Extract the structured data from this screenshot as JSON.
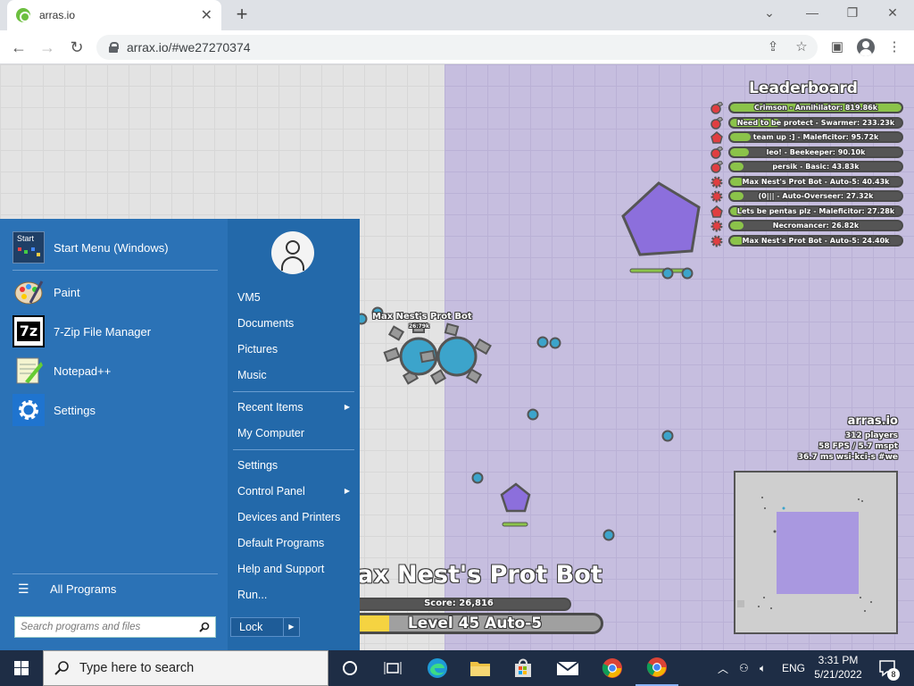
{
  "browser": {
    "tab_title": "arras.io",
    "url": "arrax.io/#we27270374"
  },
  "game": {
    "leaderboard_title": "Leaderboard",
    "leaderboard": [
      {
        "label": "Crimson - Annihilator: 819.86k",
        "fill": 1.0
      },
      {
        "label": "Need to be protect - Swarmer: 233.23k",
        "fill": 0.29
      },
      {
        "label": "team up :] - Maleficitor: 95.72k",
        "fill": 0.12
      },
      {
        "label": "leo! - Beekeeper: 90.10k",
        "fill": 0.11
      },
      {
        "label": "persik - Basic: 43.83k",
        "fill": 0.06
      },
      {
        "label": "Max Nest's Prot Bot - Auto-5: 40.43k",
        "fill": 0.05
      },
      {
        "label": "(0||| - Auto-Overseer: 27.32k",
        "fill": 0.04
      },
      {
        "label": "Lets be pentas plz - Maleficitor: 27.28k",
        "fill": 0.04
      },
      {
        "label": "Necromancer: 26.82k",
        "fill": 0.035
      },
      {
        "label": "Max Nest's Prot Bot - Auto-5: 24.40k",
        "fill": 0.03
      }
    ],
    "stats": {
      "site": "arras.io",
      "players": "312 players",
      "fps": "58 FPS / 5.7 mspt",
      "latency": "36.7 ms  wsi-kci-s #we"
    },
    "bot_label": "Max Nest's Prot Bot",
    "bot_score": "26.79k",
    "player_name": "ax Nest's Prot Bot",
    "score": "Score: 26,816",
    "level": "Level 45 Auto-5",
    "level_progress": 0.16,
    "colors": {
      "team_blue": "#3ca4cb",
      "pentagon": "#8c6fdc",
      "leader_green": "#8bc34a",
      "enemy_red": "#e03e41"
    }
  },
  "start_menu": {
    "pinned": [
      {
        "label": "Start Menu (Windows)",
        "icon": "start-menu-icon"
      },
      {
        "label": "Paint",
        "icon": "paint-palette-icon"
      },
      {
        "label": "7-Zip File Manager",
        "icon": "seven-zip-icon"
      },
      {
        "label": "Notepad++",
        "icon": "notepad-plus-plus-icon"
      },
      {
        "label": "Settings",
        "icon": "gear-icon"
      }
    ],
    "start_icon_text": "Start",
    "all_programs": "All Programs",
    "search_placeholder": "Search programs and files",
    "user": "VM5",
    "right_items": [
      {
        "label": "Documents"
      },
      {
        "label": "Pictures"
      },
      {
        "label": "Music"
      },
      {
        "label": "Recent Items"
      },
      {
        "label": "My Computer"
      },
      {
        "label": "Settings"
      },
      {
        "label": "Control Panel"
      },
      {
        "label": "Devices and Printers"
      },
      {
        "label": "Default Programs"
      },
      {
        "label": "Help and Support"
      },
      {
        "label": "Run..."
      }
    ],
    "lock": "Lock"
  },
  "taskbar": {
    "search_text": "Type here to search",
    "language": "ENG",
    "time": "3:31 PM",
    "date": "5/21/2022",
    "notification_count": "8"
  }
}
